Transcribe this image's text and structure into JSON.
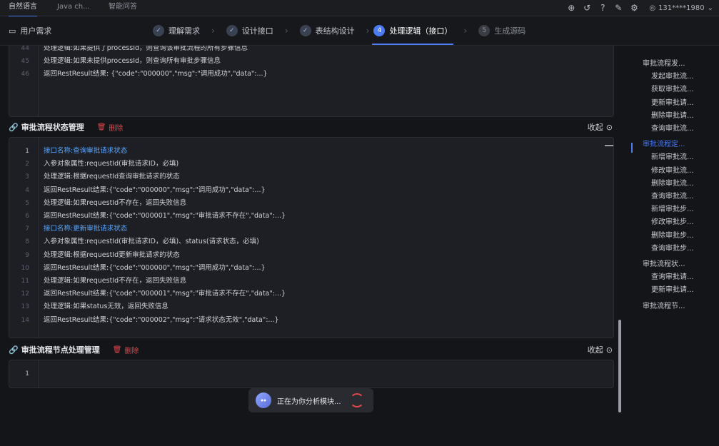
{
  "tabs": [
    "自然语言",
    "Java ch...",
    "智能问答"
  ],
  "top_icons": [
    "add-circle-icon",
    "history-icon",
    "help-icon",
    "edit-icon",
    "settings-icon"
  ],
  "user": {
    "name": "131****1980"
  },
  "requirement_label": "用户需求",
  "steps": [
    {
      "num": "",
      "label": "理解需求",
      "state": "done"
    },
    {
      "num": "",
      "label": "设计接口",
      "state": "done"
    },
    {
      "num": "",
      "label": "表结构设计",
      "state": "done"
    },
    {
      "num": "4",
      "label": "处理逻辑（接口）",
      "state": "current"
    },
    {
      "num": "5",
      "label": "生成源码",
      "state": "todo"
    }
  ],
  "top_code": {
    "lines": [
      {
        "n": "44",
        "text": "处理逻辑:如果提供了processId，则查询该审批流程的所有步骤信息"
      },
      {
        "n": "45",
        "text": "处理逻辑:如果未提供processId，则查询所有审批步骤信息"
      },
      {
        "n": "46",
        "text": "返回RestResult结果: {\"code\":\"000000\",\"msg\":\"调用成功\",\"data\":...}"
      }
    ]
  },
  "section1": {
    "title": "审批流程状态管理",
    "delete_label": "删除",
    "collapse_label": "收起",
    "lines": [
      {
        "n": "1",
        "text": "接口名称:查询审批请求状态",
        "blue": true
      },
      {
        "n": "2",
        "text": "入参对象属性:requestId(审批请求ID，必填)"
      },
      {
        "n": "3",
        "text": "处理逻辑:根据requestId查询审批请求的状态"
      },
      {
        "n": "4",
        "text": "返回RestResult结果:{\"code\":\"000000\",\"msg\":\"调用成功\",\"data\":...}"
      },
      {
        "n": "5",
        "text": "处理逻辑:如果requestId不存在，返回失败信息"
      },
      {
        "n": "6",
        "text": "返回RestResult结果:{\"code\":\"000001\",\"msg\":\"审批请求不存在\",\"data\":...}"
      },
      {
        "n": "7",
        "text": "接口名称:更新审批请求状态",
        "blue": true
      },
      {
        "n": "8",
        "text": "入参对象属性:requestId(审批请求ID，必填)、status(请求状态，必填)"
      },
      {
        "n": "9",
        "text": "处理逻辑:根据requestId更新审批请求的状态"
      },
      {
        "n": "10",
        "text": "返回RestResult结果:{\"code\":\"000000\",\"msg\":\"调用成功\",\"data\":...}"
      },
      {
        "n": "11",
        "text": "处理逻辑:如果requestId不存在，返回失败信息"
      },
      {
        "n": "12",
        "text": "返回RestResult结果:{\"code\":\"000001\",\"msg\":\"审批请求不存在\",\"data\":...}"
      },
      {
        "n": "13",
        "text": "处理逻辑:如果status无效，返回失败信息"
      },
      {
        "n": "14",
        "text": "返回RestResult结果:{\"code\":\"000002\",\"msg\":\"请求状态无效\",\"data\":...}"
      }
    ]
  },
  "section2": {
    "title": "审批流程节点处理管理",
    "delete_label": "删除",
    "collapse_label": "收起",
    "lines": [
      {
        "n": "1",
        "text": ""
      }
    ]
  },
  "toc": [
    {
      "text": "审批流程发...",
      "level": 0
    },
    {
      "text": "发起审批流...",
      "level": 1
    },
    {
      "text": "获取审批流...",
      "level": 1
    },
    {
      "text": "更新审批请...",
      "level": 1
    },
    {
      "text": "删除审批请...",
      "level": 1
    },
    {
      "text": "查询审批流...",
      "level": 1
    },
    {
      "text": "审批流程定...",
      "level": 0,
      "active": true
    },
    {
      "text": "新增审批流...",
      "level": 1
    },
    {
      "text": "修改审批流...",
      "level": 1
    },
    {
      "text": "删除审批流...",
      "level": 1
    },
    {
      "text": "查询审批流...",
      "level": 1
    },
    {
      "text": "新增审批步...",
      "level": 1
    },
    {
      "text": "修改审批步...",
      "level": 1
    },
    {
      "text": "删除审批步...",
      "level": 1
    },
    {
      "text": "查询审批步...",
      "level": 1
    },
    {
      "text": "审批流程状...",
      "level": 0
    },
    {
      "text": "查询审批请...",
      "level": 1
    },
    {
      "text": "更新审批请...",
      "level": 1
    },
    {
      "text": "审批流程节...",
      "level": 0
    }
  ],
  "toast": {
    "text": "正在为你分析模块..."
  },
  "colors": {
    "accent": "#4b7cf3",
    "danger": "#e0474c",
    "code_blue": "#5aa7ff"
  }
}
